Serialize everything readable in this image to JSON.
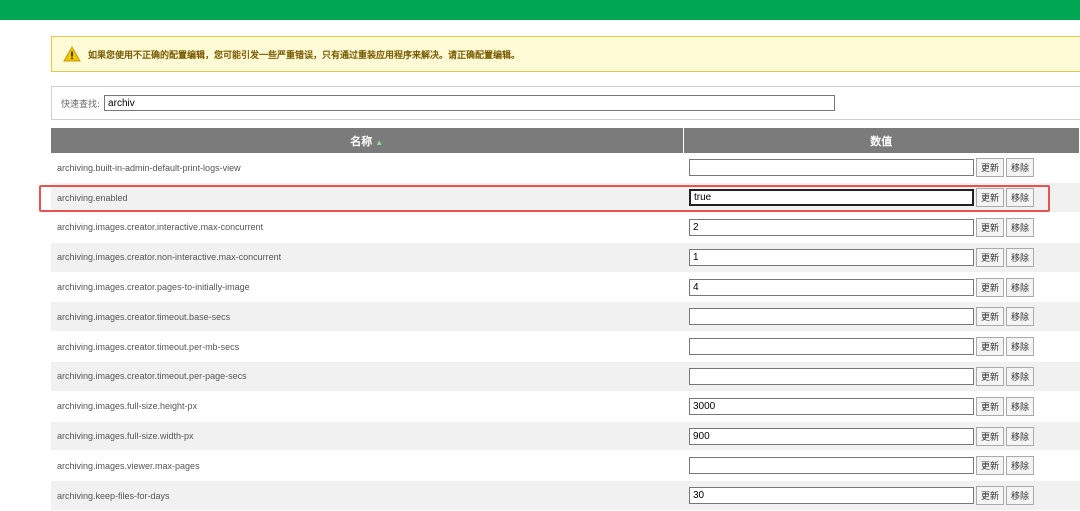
{
  "warning": {
    "text": "如果您使用不正确的配置编辑，您可能引发一些严重错误，只有通过重装应用程序来解决。请正确配置编辑。"
  },
  "filter": {
    "label": "快速查找:",
    "value": "archiv"
  },
  "table": {
    "header_name": "名称",
    "header_value": "数值",
    "update_label": "更新",
    "remove_label": "移除",
    "rows": [
      {
        "name": "archiving.built-in-admin-default-print-logs-view",
        "value": ""
      },
      {
        "name": "archiving.enabled",
        "value": "true"
      },
      {
        "name": "archiving.images.creator.interactive.max-concurrent",
        "value": "2"
      },
      {
        "name": "archiving.images.creator.non-interactive.max-concurrent",
        "value": "1"
      },
      {
        "name": "archiving.images.creator.pages-to-initially-image",
        "value": "4"
      },
      {
        "name": "archiving.images.creator.timeout.base-secs",
        "value": ""
      },
      {
        "name": "archiving.images.creator.timeout.per-mb-secs",
        "value": ""
      },
      {
        "name": "archiving.images.creator.timeout.per-page-secs",
        "value": ""
      },
      {
        "name": "archiving.images.full-size.height-px",
        "value": "3000"
      },
      {
        "name": "archiving.images.full-size.width-px",
        "value": "900"
      },
      {
        "name": "archiving.images.viewer.max-pages",
        "value": ""
      },
      {
        "name": "archiving.keep-files-for-days",
        "value": "30"
      }
    ]
  },
  "colors": {
    "topbar": "#00a651",
    "highlight": "#e8534f",
    "header": "#7b7b7b"
  }
}
